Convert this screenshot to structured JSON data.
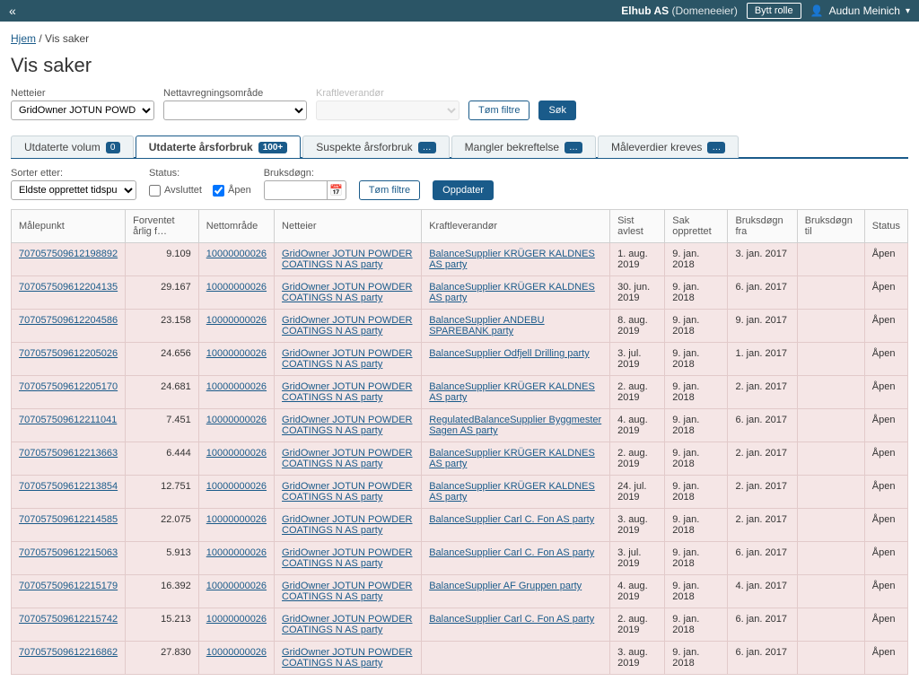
{
  "topbar": {
    "company": "Elhub AS",
    "role": "(Domeneeier)",
    "btn_role": "Bytt rolle",
    "user": "Audun Meinich"
  },
  "breadcrumb": {
    "home": "Hjem",
    "current": "Vis saker"
  },
  "page_title": "Vis saker",
  "filters": {
    "netteier": {
      "label": "Netteier",
      "value": "GridOwner JOTUN POWDER COA"
    },
    "nettavr": {
      "label": "Nettavregningsområde",
      "value": ""
    },
    "kraft": {
      "label": "Kraftleverandør",
      "value": ""
    },
    "clear": "Tøm filtre",
    "search": "Søk"
  },
  "tabs": [
    {
      "label": "Utdaterte volum",
      "badge": "0"
    },
    {
      "label": "Utdaterte årsforbruk",
      "badge": "100+"
    },
    {
      "label": "Suspekte årsforbruk",
      "badge": "…"
    },
    {
      "label": "Mangler bekreftelse",
      "badge": "…"
    },
    {
      "label": "Måleverdier kreves",
      "badge": "…"
    }
  ],
  "subfilters": {
    "sort_label": "Sorter etter:",
    "sort_value": "Eldste opprettet tidspunkt",
    "status_label": "Status:",
    "avsluttet": "Avsluttet",
    "apen": "Åpen",
    "bruksdogn_label": "Bruksdøgn:",
    "clear": "Tøm filtre",
    "update": "Oppdater"
  },
  "columns": [
    "Målepunkt",
    "Forventet årlig f…",
    "Nettområde",
    "Netteier",
    "Kraftleverandør",
    "Sist avlest",
    "Sak opprettet",
    "Bruksdøgn fra",
    "Bruksdøgn til",
    "Status"
  ],
  "rows": [
    {
      "mp": "707057509612198892",
      "forv": "9.109",
      "netto": "10000000026",
      "netteier": "GridOwner JOTUN POWDER COATINGS N AS party",
      "kraft": "BalanceSupplier KRÜGER KALDNES AS party",
      "sist": "1. aug. 2019",
      "sak": "9. jan. 2018",
      "bfra": "3. jan. 2017",
      "btil": "",
      "status": "Åpen"
    },
    {
      "mp": "707057509612204135",
      "forv": "29.167",
      "netto": "10000000026",
      "netteier": "GridOwner JOTUN POWDER COATINGS N AS party",
      "kraft": "BalanceSupplier KRÜGER KALDNES AS party",
      "sist": "30. jun. 2019",
      "sak": "9. jan. 2018",
      "bfra": "6. jan. 2017",
      "btil": "",
      "status": "Åpen"
    },
    {
      "mp": "707057509612204586",
      "forv": "23.158",
      "netto": "10000000026",
      "netteier": "GridOwner JOTUN POWDER COATINGS N AS party",
      "kraft": "BalanceSupplier ANDEBU SPAREBANK party",
      "sist": "8. aug. 2019",
      "sak": "9. jan. 2018",
      "bfra": "9. jan. 2017",
      "btil": "",
      "status": "Åpen"
    },
    {
      "mp": "707057509612205026",
      "forv": "24.656",
      "netto": "10000000026",
      "netteier": "GridOwner JOTUN POWDER COATINGS N AS party",
      "kraft": "BalanceSupplier Odfjell Drilling party",
      "sist": "3. jul. 2019",
      "sak": "9. jan. 2018",
      "bfra": "1. jan. 2017",
      "btil": "",
      "status": "Åpen"
    },
    {
      "mp": "707057509612205170",
      "forv": "24.681",
      "netto": "10000000026",
      "netteier": "GridOwner JOTUN POWDER COATINGS N AS party",
      "kraft": "BalanceSupplier KRÜGER KALDNES AS party",
      "sist": "2. aug. 2019",
      "sak": "9. jan. 2018",
      "bfra": "2. jan. 2017",
      "btil": "",
      "status": "Åpen"
    },
    {
      "mp": "707057509612211041",
      "forv": "7.451",
      "netto": "10000000026",
      "netteier": "GridOwner JOTUN POWDER COATINGS N AS party",
      "kraft": "RegulatedBalanceSupplier Byggmester Sagen AS party",
      "sist": "4. aug. 2019",
      "sak": "9. jan. 2018",
      "bfra": "6. jan. 2017",
      "btil": "",
      "status": "Åpen"
    },
    {
      "mp": "707057509612213663",
      "forv": "6.444",
      "netto": "10000000026",
      "netteier": "GridOwner JOTUN POWDER COATINGS N AS party",
      "kraft": "BalanceSupplier KRÜGER KALDNES AS party",
      "sist": "2. aug. 2019",
      "sak": "9. jan. 2018",
      "bfra": "2. jan. 2017",
      "btil": "",
      "status": "Åpen"
    },
    {
      "mp": "707057509612213854",
      "forv": "12.751",
      "netto": "10000000026",
      "netteier": "GridOwner JOTUN POWDER COATINGS N AS party",
      "kraft": "BalanceSupplier KRÜGER KALDNES AS party",
      "sist": "24. jul. 2019",
      "sak": "9. jan. 2018",
      "bfra": "2. jan. 2017",
      "btil": "",
      "status": "Åpen"
    },
    {
      "mp": "707057509612214585",
      "forv": "22.075",
      "netto": "10000000026",
      "netteier": "GridOwner JOTUN POWDER COATINGS N AS party",
      "kraft": "BalanceSupplier Carl C. Fon AS party",
      "sist": "3. aug. 2019",
      "sak": "9. jan. 2018",
      "bfra": "2. jan. 2017",
      "btil": "",
      "status": "Åpen"
    },
    {
      "mp": "707057509612215063",
      "forv": "5.913",
      "netto": "10000000026",
      "netteier": "GridOwner JOTUN POWDER COATINGS N AS party",
      "kraft": "BalanceSupplier Carl C. Fon AS party",
      "sist": "3. jul. 2019",
      "sak": "9. jan. 2018",
      "bfra": "6. jan. 2017",
      "btil": "",
      "status": "Åpen"
    },
    {
      "mp": "707057509612215179",
      "forv": "16.392",
      "netto": "10000000026",
      "netteier": "GridOwner JOTUN POWDER COATINGS N AS party",
      "kraft": "BalanceSupplier AF Gruppen party",
      "sist": "4. aug. 2019",
      "sak": "9. jan. 2018",
      "bfra": "4. jan. 2017",
      "btil": "",
      "status": "Åpen"
    },
    {
      "mp": "707057509612215742",
      "forv": "15.213",
      "netto": "10000000026",
      "netteier": "GridOwner JOTUN POWDER COATINGS N AS party",
      "kraft": "BalanceSupplier Carl C. Fon AS party",
      "sist": "2. aug. 2019",
      "sak": "9. jan. 2018",
      "bfra": "6. jan. 2017",
      "btil": "",
      "status": "Åpen"
    },
    {
      "mp": "707057509612216862",
      "forv": "27.830",
      "netto": "10000000026",
      "netteier": "GridOwner JOTUN POWDER COATINGS N AS party",
      "kraft": "",
      "sist": "3. aug. 2019",
      "sak": "9. jan. 2018",
      "bfra": "6. jan. 2017",
      "btil": "",
      "status": "Åpen"
    }
  ]
}
